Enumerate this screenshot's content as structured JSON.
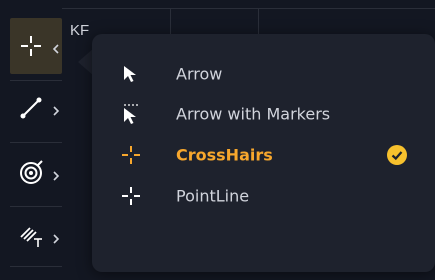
{
  "background": {
    "partial_label": "KF"
  },
  "toolbar": {
    "tools": [
      {
        "name": "crosshair-tool",
        "icon": "crosshair-icon",
        "active": true
      },
      {
        "name": "line-tool",
        "icon": "trend-line-icon",
        "active": false
      },
      {
        "name": "measure-tool",
        "icon": "target-icon",
        "active": false
      },
      {
        "name": "text-tool",
        "icon": "brush-text-icon",
        "active": false
      }
    ]
  },
  "cursor_menu": {
    "items": [
      {
        "label": "Arrow",
        "icon": "arrow-cursor-icon",
        "selected": false
      },
      {
        "label": "Arrow with Markers",
        "icon": "arrow-markers-cursor-icon",
        "selected": false
      },
      {
        "label": "CrossHairs",
        "icon": "crosshair-icon",
        "selected": true
      },
      {
        "label": "PointLine",
        "icon": "pointline-icon",
        "selected": false
      }
    ]
  },
  "colors": {
    "background": "#131722",
    "menu_background": "#1e222d",
    "text": "#d1d4dc",
    "accent": "#f7a72d",
    "active_tool_bg": "#3a3528"
  }
}
